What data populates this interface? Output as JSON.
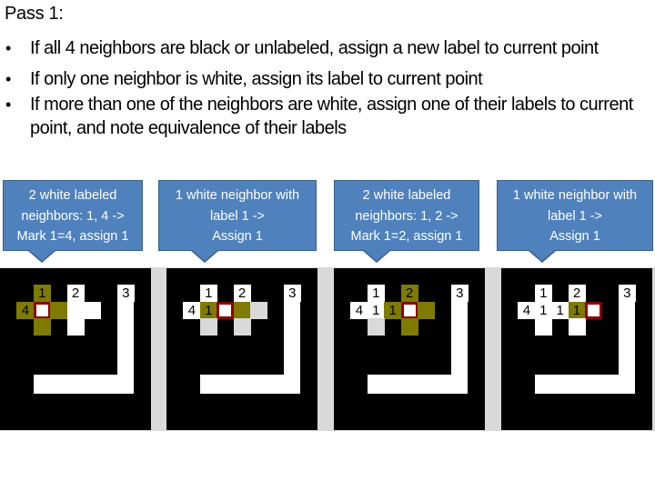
{
  "slide": {
    "title": "Pass 1:",
    "bullets": [
      "If all 4 neighbors are black or unlabeled, assign a new label to current point",
      "If only one neighbor is white, assign its label to current point",
      "If more than one of the neighbors are white, assign one of their labels to current point, and note equivalence of their labels"
    ],
    "bullet_symbol": "•"
  },
  "callouts": [
    {
      "lines": [
        "2 white labeled",
        "neighbors: 1, 4 ->",
        "Mark 1=4, assign 1"
      ]
    },
    {
      "lines": [
        "1 white neighbor with",
        "label 1 ->",
        "Assign 1"
      ]
    },
    {
      "lines": [
        "2 white labeled",
        "neighbors: 1, 2 ->",
        "Mark 1=2, assign 1"
      ]
    },
    {
      "lines": [
        "1 white neighbor with",
        "label 1 ->",
        "Assign 1"
      ]
    }
  ],
  "colors": {
    "callout_fill": "#4f81bd",
    "callout_border": "#385d8a",
    "neighbor_highlight": "#7f7a00",
    "current_marker": "#8b0000",
    "unlabeled_white": "#d9d9d9"
  },
  "panels": [
    {
      "step": 1,
      "cells": [
        {
          "col": 2,
          "row": 1,
          "state": "olive",
          "label": "1"
        },
        {
          "col": 4,
          "row": 1,
          "state": "white",
          "label": "2"
        },
        {
          "col": 7,
          "row": 1,
          "state": "white",
          "label": "3"
        },
        {
          "col": 1,
          "row": 2,
          "state": "olive",
          "label": "4"
        },
        {
          "col": 2,
          "row": 2,
          "state": "current",
          "label": ""
        },
        {
          "col": 3,
          "row": 2,
          "state": "olive",
          "label": ""
        },
        {
          "col": 4,
          "row": 2,
          "state": "white",
          "label": ""
        },
        {
          "col": 5,
          "row": 2,
          "state": "white",
          "label": ""
        },
        {
          "col": 2,
          "row": 3,
          "state": "olive",
          "label": ""
        },
        {
          "col": 4,
          "row": 3,
          "state": "white",
          "label": ""
        }
      ]
    },
    {
      "step": 2,
      "cells": [
        {
          "col": 2,
          "row": 1,
          "state": "white",
          "label": "1"
        },
        {
          "col": 4,
          "row": 1,
          "state": "white",
          "label": "2"
        },
        {
          "col": 7,
          "row": 1,
          "state": "white",
          "label": "3"
        },
        {
          "col": 1,
          "row": 2,
          "state": "white",
          "label": "4"
        },
        {
          "col": 2,
          "row": 2,
          "state": "olive",
          "label": "1"
        },
        {
          "col": 3,
          "row": 2,
          "state": "current",
          "label": ""
        },
        {
          "col": 4,
          "row": 2,
          "state": "olive",
          "label": ""
        },
        {
          "col": 5,
          "row": 2,
          "state": "gray",
          "label": ""
        },
        {
          "col": 2,
          "row": 3,
          "state": "gray",
          "label": ""
        },
        {
          "col": 4,
          "row": 3,
          "state": "gray",
          "label": ""
        }
      ]
    },
    {
      "step": 3,
      "cells": [
        {
          "col": 2,
          "row": 1,
          "state": "white",
          "label": "1"
        },
        {
          "col": 4,
          "row": 1,
          "state": "olive",
          "label": "2"
        },
        {
          "col": 7,
          "row": 1,
          "state": "white",
          "label": "3"
        },
        {
          "col": 1,
          "row": 2,
          "state": "white",
          "label": "4"
        },
        {
          "col": 2,
          "row": 2,
          "state": "white",
          "label": "1"
        },
        {
          "col": 3,
          "row": 2,
          "state": "olive",
          "label": "1"
        },
        {
          "col": 4,
          "row": 2,
          "state": "current",
          "label": ""
        },
        {
          "col": 5,
          "row": 2,
          "state": "olive",
          "label": ""
        },
        {
          "col": 2,
          "row": 3,
          "state": "gray",
          "label": ""
        },
        {
          "col": 4,
          "row": 3,
          "state": "olive",
          "label": ""
        }
      ]
    },
    {
      "step": 4,
      "cells": [
        {
          "col": 2,
          "row": 1,
          "state": "white",
          "label": "1"
        },
        {
          "col": 4,
          "row": 1,
          "state": "white",
          "label": "2"
        },
        {
          "col": 7,
          "row": 1,
          "state": "white",
          "label": "3"
        },
        {
          "col": 1,
          "row": 2,
          "state": "white",
          "label": "4"
        },
        {
          "col": 2,
          "row": 2,
          "state": "white",
          "label": "1"
        },
        {
          "col": 3,
          "row": 2,
          "state": "white",
          "label": "1"
        },
        {
          "col": 4,
          "row": 2,
          "state": "olive",
          "label": "1"
        },
        {
          "col": 5,
          "row": 2,
          "state": "current",
          "label": ""
        },
        {
          "col": 2,
          "row": 3,
          "state": "white",
          "label": ""
        },
        {
          "col": 4,
          "row": 3,
          "state": "white",
          "label": ""
        }
      ]
    }
  ]
}
